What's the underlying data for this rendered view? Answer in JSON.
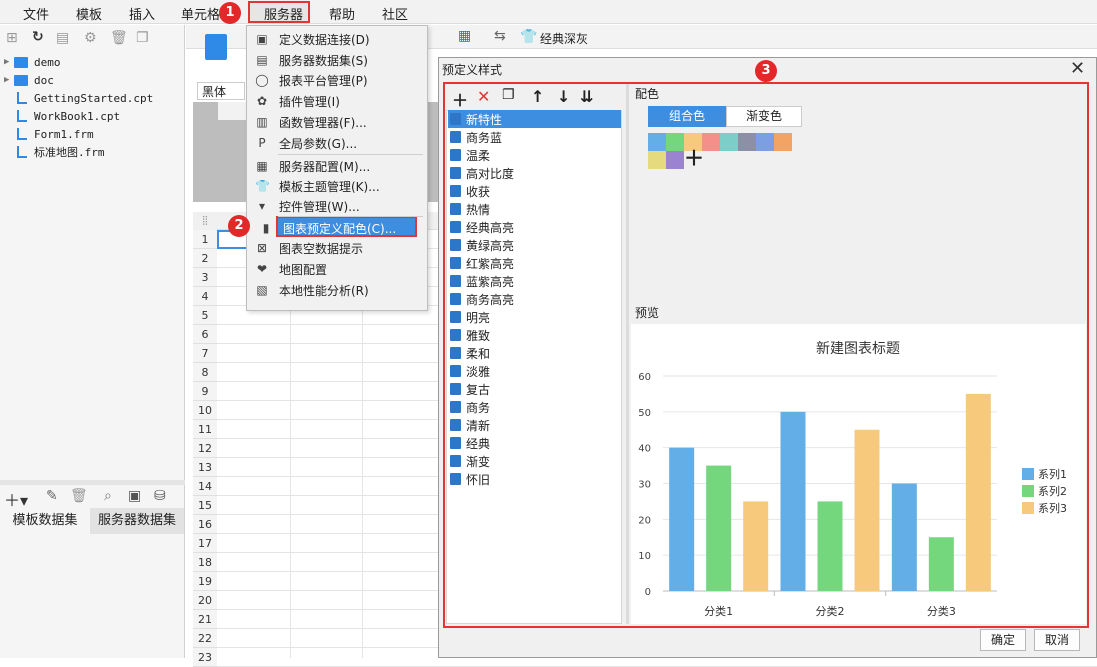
{
  "menubar": {
    "items": [
      "文件",
      "模板",
      "插入",
      "单元格",
      "服务器",
      "帮助",
      "社区"
    ],
    "badge1": "1",
    "badge2": "2",
    "badge3": "3"
  },
  "left_panel": {
    "tree": [
      {
        "type": "folder",
        "name": "demo"
      },
      {
        "type": "folder",
        "name": "doc"
      },
      {
        "type": "file",
        "name": "GettingStarted.cpt"
      },
      {
        "type": "file",
        "name": "WorkBook1.cpt"
      },
      {
        "type": "file",
        "name": "Form1.frm"
      },
      {
        "type": "file",
        "name": "标准地图.frm"
      }
    ],
    "tabs": [
      "模板数据集",
      "服务器数据集"
    ]
  },
  "toolbar": {
    "theme_label": "经典深灰",
    "font_name": "黑体"
  },
  "sheet": {
    "rows": [
      "1",
      "2",
      "3",
      "4",
      "5",
      "6",
      "7",
      "8",
      "9",
      "10",
      "11",
      "12",
      "13",
      "14",
      "15",
      "16",
      "17",
      "18",
      "19",
      "20",
      "21",
      "22",
      "23"
    ]
  },
  "server_menu": {
    "items": [
      "定义数据连接(D)",
      "服务器数据集(S)",
      "报表平台管理(P)",
      "插件管理(I)",
      "函数管理器(F)...",
      "全局参数(G)...",
      "服务器配置(M)...",
      "模板主题管理(K)...",
      "控件管理(W)...",
      "图表预定义配色(C)...",
      "图表空数据提示",
      "地图配置",
      "本地性能分析(R)"
    ]
  },
  "dialog": {
    "title": "预定义样式",
    "styles": [
      "新特性",
      "商务蓝",
      "温柔",
      "高对比度",
      "收获",
      "热情",
      "经典高亮",
      "黄绿高亮",
      "红紫高亮",
      "蓝紫高亮",
      "商务高亮",
      "明亮",
      "雅致",
      "柔和",
      "淡雅",
      "复古",
      "商务",
      "清新",
      "经典",
      "渐变",
      "怀旧"
    ],
    "selected_style": "新特性",
    "color_label": "配色",
    "tab_combo": "组合色",
    "tab_gradient": "渐变色",
    "swatches": [
      "#63aee6",
      "#74d67d",
      "#f7c97d",
      "#f58f8a",
      "#7ccfc9",
      "#8d8fa7",
      "#7c9fe3",
      "#f3a465",
      "#e6da7f",
      "#9b83d1"
    ],
    "preview_label": "预览",
    "ok": "确定",
    "cancel": "取消"
  },
  "chart_data": {
    "type": "bar",
    "title": "新建图表标题",
    "categories": [
      "分类1",
      "分类2",
      "分类3"
    ],
    "series": [
      {
        "name": "系列1",
        "values": [
          40,
          50,
          30
        ],
        "color": "#63aee6"
      },
      {
        "name": "系列2",
        "values": [
          35,
          25,
          15
        ],
        "color": "#74d67d"
      },
      {
        "name": "系列3",
        "values": [
          25,
          45,
          55
        ],
        "color": "#f7c97d"
      }
    ],
    "ylim": [
      0,
      60
    ],
    "yticks": [
      0,
      10,
      20,
      30,
      40,
      50,
      60
    ],
    "grid": true,
    "legend": "right"
  }
}
